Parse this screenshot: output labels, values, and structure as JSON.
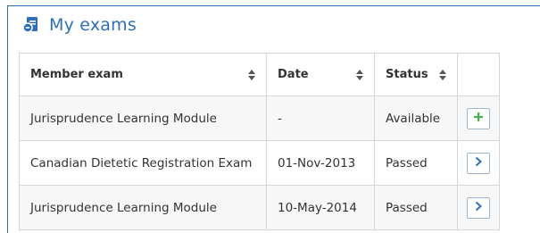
{
  "panel": {
    "title": "My exams",
    "icon": "exam-document-icon",
    "accent_color": "#2f6fb5"
  },
  "table": {
    "columns": [
      {
        "label": "Member exam",
        "sortable": true
      },
      {
        "label": "Date",
        "sortable": true
      },
      {
        "label": "Status",
        "sortable": true
      },
      {
        "label": "",
        "sortable": false
      }
    ],
    "rows": [
      {
        "exam": "Jurisprudence Learning Module",
        "date": "-",
        "status": "Available",
        "action": "plus-icon",
        "action_color": "#4caf50"
      },
      {
        "exam": "Canadian Dietetic Registration Exam",
        "date": "01-Nov-2013",
        "status": "Passed",
        "action": "chevron-right-icon",
        "action_color": "#2f6fb5"
      },
      {
        "exam": "Jurisprudence Learning Module",
        "date": "10-May-2014",
        "status": "Passed",
        "action": "chevron-right-icon",
        "action_color": "#2f6fb5"
      }
    ]
  }
}
